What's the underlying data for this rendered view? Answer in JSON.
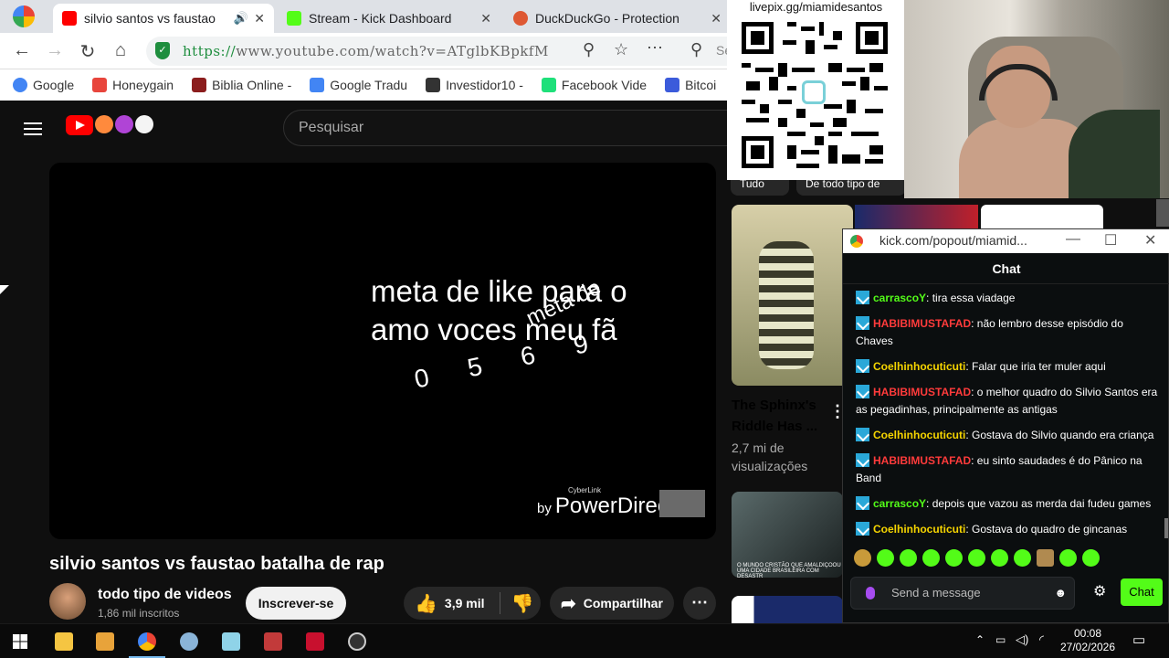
{
  "browser": {
    "tabs": [
      {
        "title": "silvio santos vs faustao",
        "active": true,
        "color": "#ff0000"
      },
      {
        "title": "Stream - Kick Dashboard",
        "active": false,
        "color": "#53fc18"
      },
      {
        "title": "DuckDuckGo - Protection",
        "active": false,
        "color": "#de5833"
      }
    ],
    "url_scheme": "https://",
    "url_rest": "www.youtube.com/watch?v=ATglbKBpkfM",
    "search_stub": "Se",
    "bookmarks": [
      {
        "label": "Google",
        "color": "#4285f4"
      },
      {
        "label": "Honeygain",
        "color": "#e8453c"
      },
      {
        "label": "Biblia Online -",
        "color": "#8b1d1d"
      },
      {
        "label": "Google Tradu",
        "color": "#4285f4"
      },
      {
        "label": "Investidor10 -",
        "color": "#333333"
      },
      {
        "label": "Facebook Vide",
        "color": "#1ee07a"
      },
      {
        "label": "Bitcoi",
        "color": "#3b5bdb"
      }
    ]
  },
  "youtube": {
    "search_placeholder": "Pesquisar",
    "video_overlay": {
      "line1": "meta de like para o",
      "line2": "amo voces meu fã",
      "scatter": "0 5 6 9",
      "scatter2": "meta de",
      "watermark_by": "by",
      "watermark": "PowerDirector",
      "watermark_small": "CyberLink"
    },
    "video_title": "silvio santos vs faustao batalha de rap",
    "channel_name": "todo tipo de videos",
    "subscribers": "1,86 mil inscritos",
    "subscribe_label": "Inscrever-se",
    "likes": "3,9 mil",
    "share_label": "Compartilhar",
    "chips": [
      "Tudo",
      "De todo tipo de"
    ],
    "sidebar_video": {
      "title": "The Sphinx's Riddle Has ...",
      "meta": "2,7 mi de visualizações"
    },
    "thumb_caption": "O MUNDO CRISTÃO QUE AMALDIÇOOU UMA CIDADE BRASILEIRA COM DESASTR"
  },
  "overlay_qr": {
    "label": "livepix.gg/miamidesantos"
  },
  "chat_window": {
    "title": "kick.com/popout/miamid...",
    "header": "Chat",
    "messages": [
      {
        "user": "carrascoY",
        "user_color": "#53fc18",
        "text": "tira essa viadage"
      },
      {
        "user": "HABIBIMUSTAFAD",
        "user_color": "#ff3b3b",
        "text": "não lembro desse episódio do Chaves"
      },
      {
        "user": "Coelhinhocuticuti",
        "user_color": "#f5d400",
        "text": "Falar que iria ter muler aqui"
      },
      {
        "user": "HABIBIMUSTAFAD",
        "user_color": "#ff3b3b",
        "text": "o melhor quadro do Silvio Santos era as pegadinhas, principalmente as antigas"
      },
      {
        "user": "Coelhinhocuticuti",
        "user_color": "#f5d400",
        "text": "Gostava do Silvio quando era criança"
      },
      {
        "user": "HABIBIMUSTAFAD",
        "user_color": "#ff3b3b",
        "text": "eu sinto saudades é do Pânico na Band"
      },
      {
        "user": "carrascoY",
        "user_color": "#53fc18",
        "text": "depois que vazou as merda dai fudeu games"
      },
      {
        "user": "Coelhinhocuticuti",
        "user_color": "#f5d400",
        "text": "Gostava do quadro de gincanas"
      }
    ],
    "send_placeholder": "Send a message",
    "chat_button": "Chat"
  },
  "taskbar": {
    "time": "00:08",
    "date": "27/02/2026"
  }
}
